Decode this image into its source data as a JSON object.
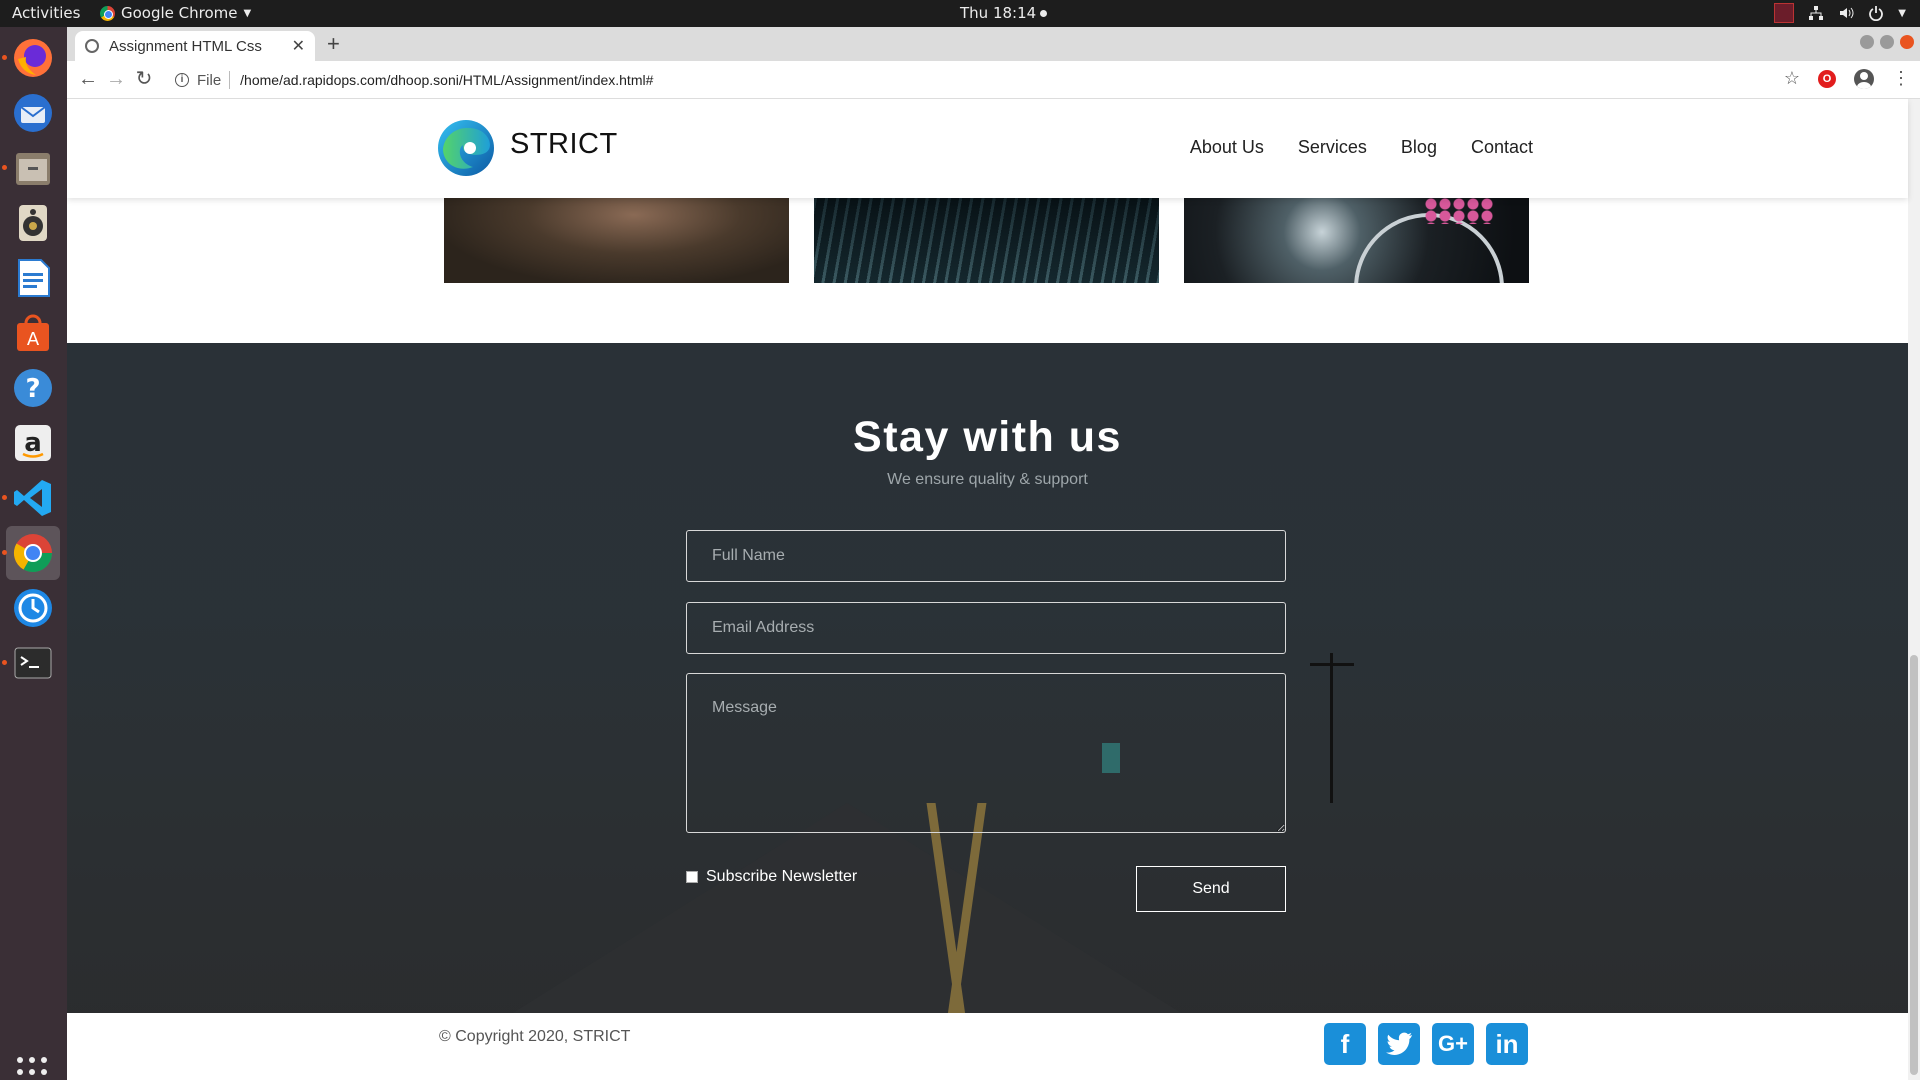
{
  "os": {
    "activities_label": "Activities",
    "app_name": "Google Chrome",
    "clock": "Thu 18:14"
  },
  "dock": {
    "items": [
      {
        "name": "firefox",
        "color": "#ff7139"
      },
      {
        "name": "thunderbird",
        "color": "#2a6fcf"
      },
      {
        "name": "files",
        "color": "#8a7d6b"
      },
      {
        "name": "rhythmbox",
        "color": "#c9a84a"
      },
      {
        "name": "libreoffice-writer",
        "color": "#2b7bd1"
      },
      {
        "name": "ubuntu-software",
        "color": "#e95420"
      },
      {
        "name": "help",
        "color": "#3a8bd8"
      },
      {
        "name": "amazon",
        "color": "#e8e8e8"
      },
      {
        "name": "vscode",
        "color": "#23a9f2"
      },
      {
        "name": "chrome",
        "color": "#4285f4"
      },
      {
        "name": "timeshift",
        "color": "#1e88e5"
      },
      {
        "name": "terminal",
        "color": "#2c2c2c"
      }
    ]
  },
  "browser": {
    "tab_title": "Assignment HTML Css",
    "new_tab_label": "+",
    "url_scheme": "File",
    "url": "/home/ad.rapidops.com/dhoop.soni/HTML/Assignment/index.html#"
  },
  "site": {
    "brand": "STRICT",
    "nav": [
      "About Us",
      "Services",
      "Blog",
      "Contact"
    ],
    "contact": {
      "title": "Stay with us",
      "subtitle": "We ensure quality & support",
      "name_placeholder": "Full Name",
      "email_placeholder": "Email Address",
      "message_placeholder": "Message",
      "subscribe_label": "Subscribe Newsletter",
      "send_label": "Send"
    },
    "footer": {
      "copyright": "© Copyright 2020, STRICT",
      "social": [
        "f",
        "t",
        "G+",
        "in"
      ]
    },
    "accent_color": "#1a8fd9"
  }
}
